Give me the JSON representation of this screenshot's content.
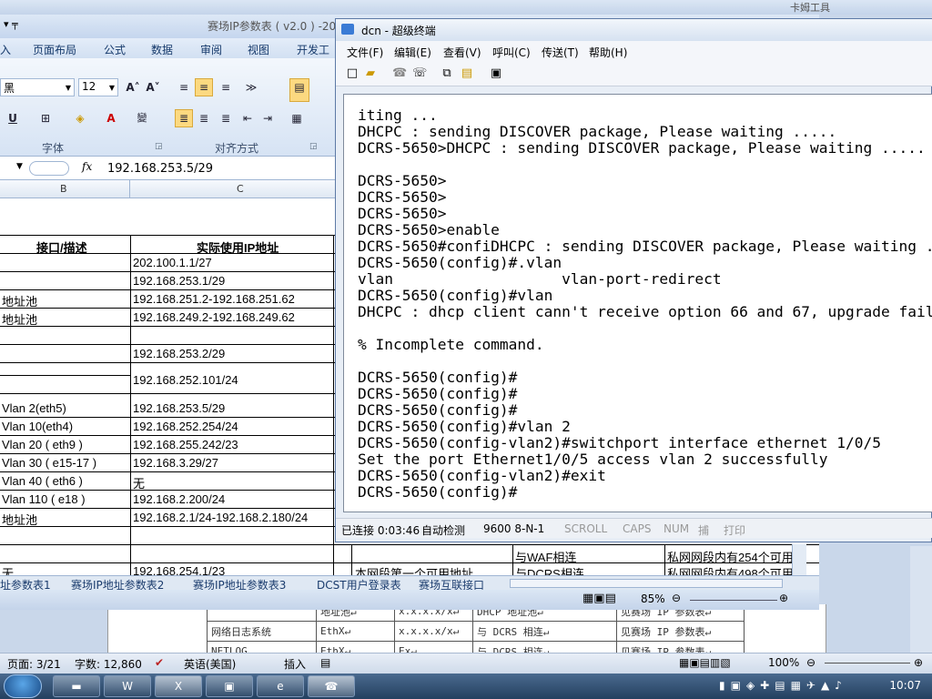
{
  "word": {
    "title_fragment": "卡姆工具",
    "table_rows": [
      [
        "地址池↵",
        "x.x.x.x/x↵",
        "DHCP 地址池↵",
        "见赛场 IP 参数表↵"
      ],
      [
        "网络日志系统",
        "EthX↵",
        "x.x.x.x/x↵",
        "与 DCRS 相连↵",
        "见赛场 IP 参数表↵"
      ],
      [
        "NETLOG",
        "EthX↵",
        "Ex↵",
        "与 DCRS 相连↵",
        "见赛场 IP 参数表↵"
      ]
    ],
    "status": {
      "page": "页面: 3/21",
      "words": "字数: 12,860",
      "lang": "英语(美国)",
      "insert": "插入",
      "zoom": "100%"
    }
  },
  "excel": {
    "title": "赛场IP参数表 ( v2.0 ) -20",
    "menu": [
      "入",
      "页面布局",
      "公式",
      "数据",
      "审阅",
      "视图",
      "开发工"
    ],
    "font_name": "黑",
    "font_size": "12",
    "group_font": "字体",
    "group_align": "对齐方式",
    "formula_value": "192.168.253.5/29",
    "fx": "fx",
    "col_b": "B",
    "col_c": "C",
    "header_b": "接口/描述",
    "header_c": "实际使用IP地址",
    "rows": [
      {
        "b": "",
        "c": "202.100.1.1/27"
      },
      {
        "b": "",
        "c": "192.168.253.1/29"
      },
      {
        "b": "地址池",
        "c": "192.168.251.2-192.168.251.62"
      },
      {
        "b": "地址池",
        "c": "192.168.249.2-192.168.249.62"
      },
      {
        "b": "",
        "c": ""
      },
      {
        "b": "",
        "c": "192.168.253.2/29"
      },
      {
        "b": "",
        "c": "192.168.252.101/24"
      },
      {
        "b": "Vlan 2(eth5)",
        "c": "192.168.253.5/29"
      },
      {
        "b": "Vlan 10(eth4)",
        "c": "192.168.252.254/24"
      },
      {
        "b": "Vlan 20 ( eth9 )",
        "c": "192.168.255.242/23"
      },
      {
        "b": "Vlan 30 ( e15-17 )",
        "c": "192.168.3.29/27"
      },
      {
        "b": "Vlan 40 ( eth6 )",
        "c": "无"
      },
      {
        "b": "Vlan 110 ( e18 )",
        "c": "192.168.2.200/24"
      },
      {
        "b": "地址池",
        "c": "192.168.2.1/24-192.168.2.180/24"
      }
    ],
    "bottom_row": {
      "b": "无",
      "c": "192.168.254.1/23",
      "d": "本网段第一个可用地址",
      "e": "与DCRS相连",
      "f": "私网网段内有498个可用"
    },
    "row_waf": {
      "e": "与WAF相连",
      "f": "私网网段内有254个可用"
    },
    "tabs": [
      "址参数表1",
      "赛场IP地址参数表2",
      "赛场IP地址参数表3",
      "DCST用户登录表",
      "赛场互联接口"
    ],
    "zoom": "85%"
  },
  "terminal": {
    "title": "dcn - 超级终端",
    "menu": [
      "文件(F)",
      "编辑(E)",
      "查看(V)",
      "呼叫(C)",
      "传送(T)",
      "帮助(H)"
    ],
    "lines": [
      "iting ...",
      "DHCPC : sending DISCOVER package, Please waiting .....",
      "DCRS-5650>DHCPC : sending DISCOVER package, Please waiting .....",
      "",
      "DCRS-5650>",
      "DCRS-5650>",
      "DCRS-5650>",
      "DCRS-5650>enable",
      "DCRS-5650#confiDHCPC : sending DISCOVER package, Please waiting .....",
      "DCRS-5650(config)#.vlan",
      "vlan                   vlan-port-redirect",
      "DCRS-5650(config)#vlan",
      "DHCPC : dhcp client cann't receive option 66 and 67, upgrade fail",
      "",
      "% Incomplete command.",
      "",
      "DCRS-5650(config)#",
      "DCRS-5650(config)#",
      "DCRS-5650(config)#",
      "DCRS-5650(config)#vlan 2",
      "DCRS-5650(config-vlan2)#switchport interface ethernet 1/0/5",
      "Set the port Ethernet1/0/5 access vlan 2 successfully",
      "DCRS-5650(config-vlan2)#exit",
      "DCRS-5650(config)#"
    ],
    "status": {
      "conn": "已连接 0:03:46",
      "detect": "自动检测",
      "baud": "9600 8-N-1",
      "scroll": "SCROLL",
      "caps": "CAPS",
      "num": "NUM",
      "capture": "捕",
      "print": "打印"
    }
  },
  "taskbar": {
    "clock": "10:07"
  }
}
